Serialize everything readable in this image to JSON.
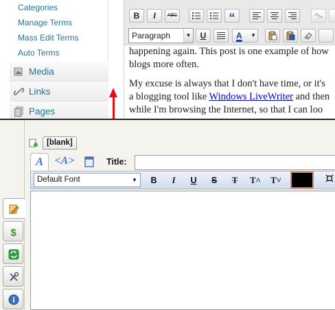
{
  "wordpress": {
    "submenu": [
      "Categories",
      "Manage Terms",
      "Mass Edit Terms",
      "Auto Terms"
    ],
    "menu": [
      {
        "label": "Media",
        "icon": "media-icon"
      },
      {
        "label": "Links",
        "icon": "links-icon"
      },
      {
        "label": "Pages",
        "icon": "pages-icon"
      }
    ],
    "toolbar": {
      "bold": "B",
      "italic": "I",
      "strike": "ABC",
      "quote": "“",
      "format_value": "Paragraph",
      "underline": "U",
      "textcolor": "A"
    },
    "content": {
      "line1": "happening again. This post is one example of how",
      "line2": "blogs more often.",
      "line3": "My excuse is always that I don't have time, or it's",
      "line4_pre": "a blogging tool like ",
      "line4_link": "Windows LiveWriter",
      "line4_post": " and then",
      "line5": "while I'm browsing the Internet, so that I can loo"
    }
  },
  "tool": {
    "doc_tab": "[blank]",
    "view_tabs": [
      {
        "icon": "rich-text-icon",
        "text": "A"
      },
      {
        "icon": "html-view-icon",
        "text": "<A>"
      },
      {
        "icon": "preview-icon",
        "text": ""
      }
    ],
    "title_label": "Title:",
    "title_value": "",
    "font_value": "Default Font",
    "format_buttons": {
      "bold": "B",
      "italic": "I",
      "underline": "U",
      "strike": "S",
      "clear": "T",
      "grow": "T˄",
      "shrink": "T˅"
    },
    "side_tabs": [
      "compose-icon",
      "dollar-icon",
      "sync-icon",
      "tools-icon",
      "info-icon"
    ],
    "colors": {
      "arrow": "#e01010",
      "link": "#21759b",
      "swatch": "#000000"
    }
  }
}
